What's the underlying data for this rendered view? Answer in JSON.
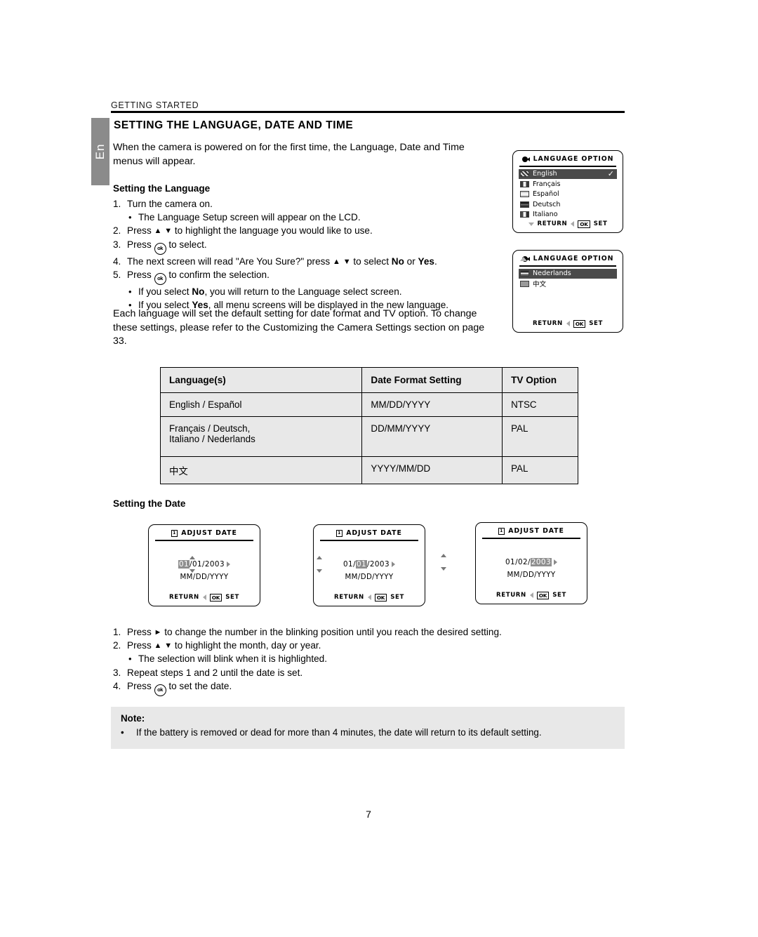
{
  "header": {
    "running_head": "GETTING STARTED",
    "language_tab": "En",
    "title": "SETTING THE LANGUAGE, DATE AND TIME"
  },
  "intro": "When the camera is powered on for the first time, the Language, Date and Time menus will appear.",
  "language_section": {
    "heading": "Setting the Language",
    "steps": [
      {
        "num": "1.",
        "pre": "Turn the camera on.",
        "icons": []
      },
      {
        "num": "2.",
        "pre": "Press",
        "mid": "to highlight the language you would like to use.",
        "icons": [
          "triangle-up",
          "triangle-down"
        ]
      },
      {
        "num": "3.",
        "pre": "Press",
        "mid": "to select.",
        "icons": [
          "ok-button"
        ]
      },
      {
        "num": "4.",
        "pre": "The next screen will read \"Are You Sure?\" press",
        "mid": "to select",
        "bold1": "No",
        "conj": "or",
        "bold2": "Yes",
        "post": ".",
        "icons": [
          "triangle-up",
          "triangle-down"
        ]
      },
      {
        "num": "5.",
        "pre": "Press",
        "mid": "to confirm the selection.",
        "icons": [
          "ok-button"
        ]
      }
    ],
    "sub_bullets_1": "The Language Setup screen will appear on the LCD.",
    "sub_bullets_5": [
      {
        "pre": "If you select",
        "bold": "No",
        "post": ", you will return to the Language select screen."
      },
      {
        "pre": "If you select",
        "bold": "Yes",
        "post": ", all menu screens will be displayed in the new language."
      }
    ],
    "paragraph": "Each language will set the default setting for date format and TV option.  To change these settings, please refer to the Customizing the Camera Settings section on page 33."
  },
  "language_table": {
    "columns": [
      "Language(s)",
      "Date Format Setting",
      "TV Option"
    ],
    "rows": [
      {
        "languages": "English / Español",
        "languages_2": "",
        "format": "MM/DD/YYYY",
        "tv": "NTSC"
      },
      {
        "languages": "Français / Deutsch,",
        "languages_2": "Italiano / Nederlands",
        "format": "DD/MM/YYYY",
        "tv": "PAL"
      },
      {
        "languages": "中文",
        "languages_2": "",
        "format": "YYYY/MM/DD",
        "tv": "PAL"
      }
    ]
  },
  "lcd_language_screen_1": {
    "title": "LANGUAGE OPTION",
    "items": [
      {
        "label": "English",
        "flag": "uk-flag-icon",
        "selected": true,
        "check": "✓"
      },
      {
        "label": "Français",
        "flag": "france-flag-icon",
        "selected": false,
        "check": ""
      },
      {
        "label": "Español",
        "flag": "spain-flag-icon",
        "selected": false,
        "check": ""
      },
      {
        "label": "Deutsch",
        "flag": "germany-flag-icon",
        "selected": false,
        "check": ""
      },
      {
        "label": "Italiano",
        "flag": "italy-flag-icon",
        "selected": false,
        "check": ""
      }
    ],
    "footer": {
      "return": "RETURN",
      "ok": "OK",
      "set": "SET"
    }
  },
  "lcd_language_screen_2": {
    "title": "LANGUAGE OPTION",
    "items": [
      {
        "label": "Nederlands",
        "flag": "netherlands-flag-icon",
        "selected": true,
        "check": ""
      },
      {
        "label": "中文",
        "flag": "china-flag-icon",
        "selected": false,
        "check": ""
      }
    ],
    "footer": {
      "return": "RETURN",
      "ok": "OK",
      "set": "SET"
    }
  },
  "date_section": {
    "heading": "Setting the Date",
    "screens": [
      {
        "title": "ADJUST DATE",
        "month": "01",
        "day": "01",
        "year": "2003",
        "highlight": "month",
        "format": "MM/DD/YYYY",
        "footer": {
          "return": "RETURN",
          "ok": "OK",
          "set": "SET"
        }
      },
      {
        "title": "ADJUST DATE",
        "month": "01",
        "day": "01",
        "year": "2003",
        "highlight": "day",
        "format": "MM/DD/YYYY",
        "footer": {
          "return": "RETURN",
          "ok": "OK",
          "set": "SET"
        }
      },
      {
        "title": "ADJUST DATE",
        "month": "01",
        "day": "02",
        "year": "2003",
        "highlight": "year",
        "format": "MM/DD/YYYY",
        "footer": {
          "return": "RETURN",
          "ok": "OK",
          "set": "SET"
        }
      }
    ],
    "steps": [
      {
        "num": "1.",
        "pre": "Press",
        "mid": "to change the number in the blinking position until you reach the desired setting.",
        "icons": [
          "triangle-right"
        ]
      },
      {
        "num": "2.",
        "pre": "Press",
        "mid": "to highlight the month, day or year.",
        "icons": [
          "triangle-up",
          "triangle-down"
        ]
      },
      {
        "num": "3.",
        "pre": "Repeat steps 1 and 2 until the date is set.",
        "icons": []
      },
      {
        "num": "4.",
        "pre": "Press",
        "mid": "to set the date.",
        "icons": [
          "ok-button"
        ]
      }
    ],
    "sub_bullet_2": "The selection will blink when it is highlighted."
  },
  "note": {
    "title": "Note:",
    "bullet": "If the battery is removed or dead for more than 4 minutes, the date will return to its default setting."
  },
  "page_number": "7",
  "glyphs": {
    "triangle_up": "▲",
    "triangle_down": "▼",
    "triangle_right": "►",
    "ok_label": "ok",
    "bullet_dot": "•",
    "slash": "/"
  }
}
